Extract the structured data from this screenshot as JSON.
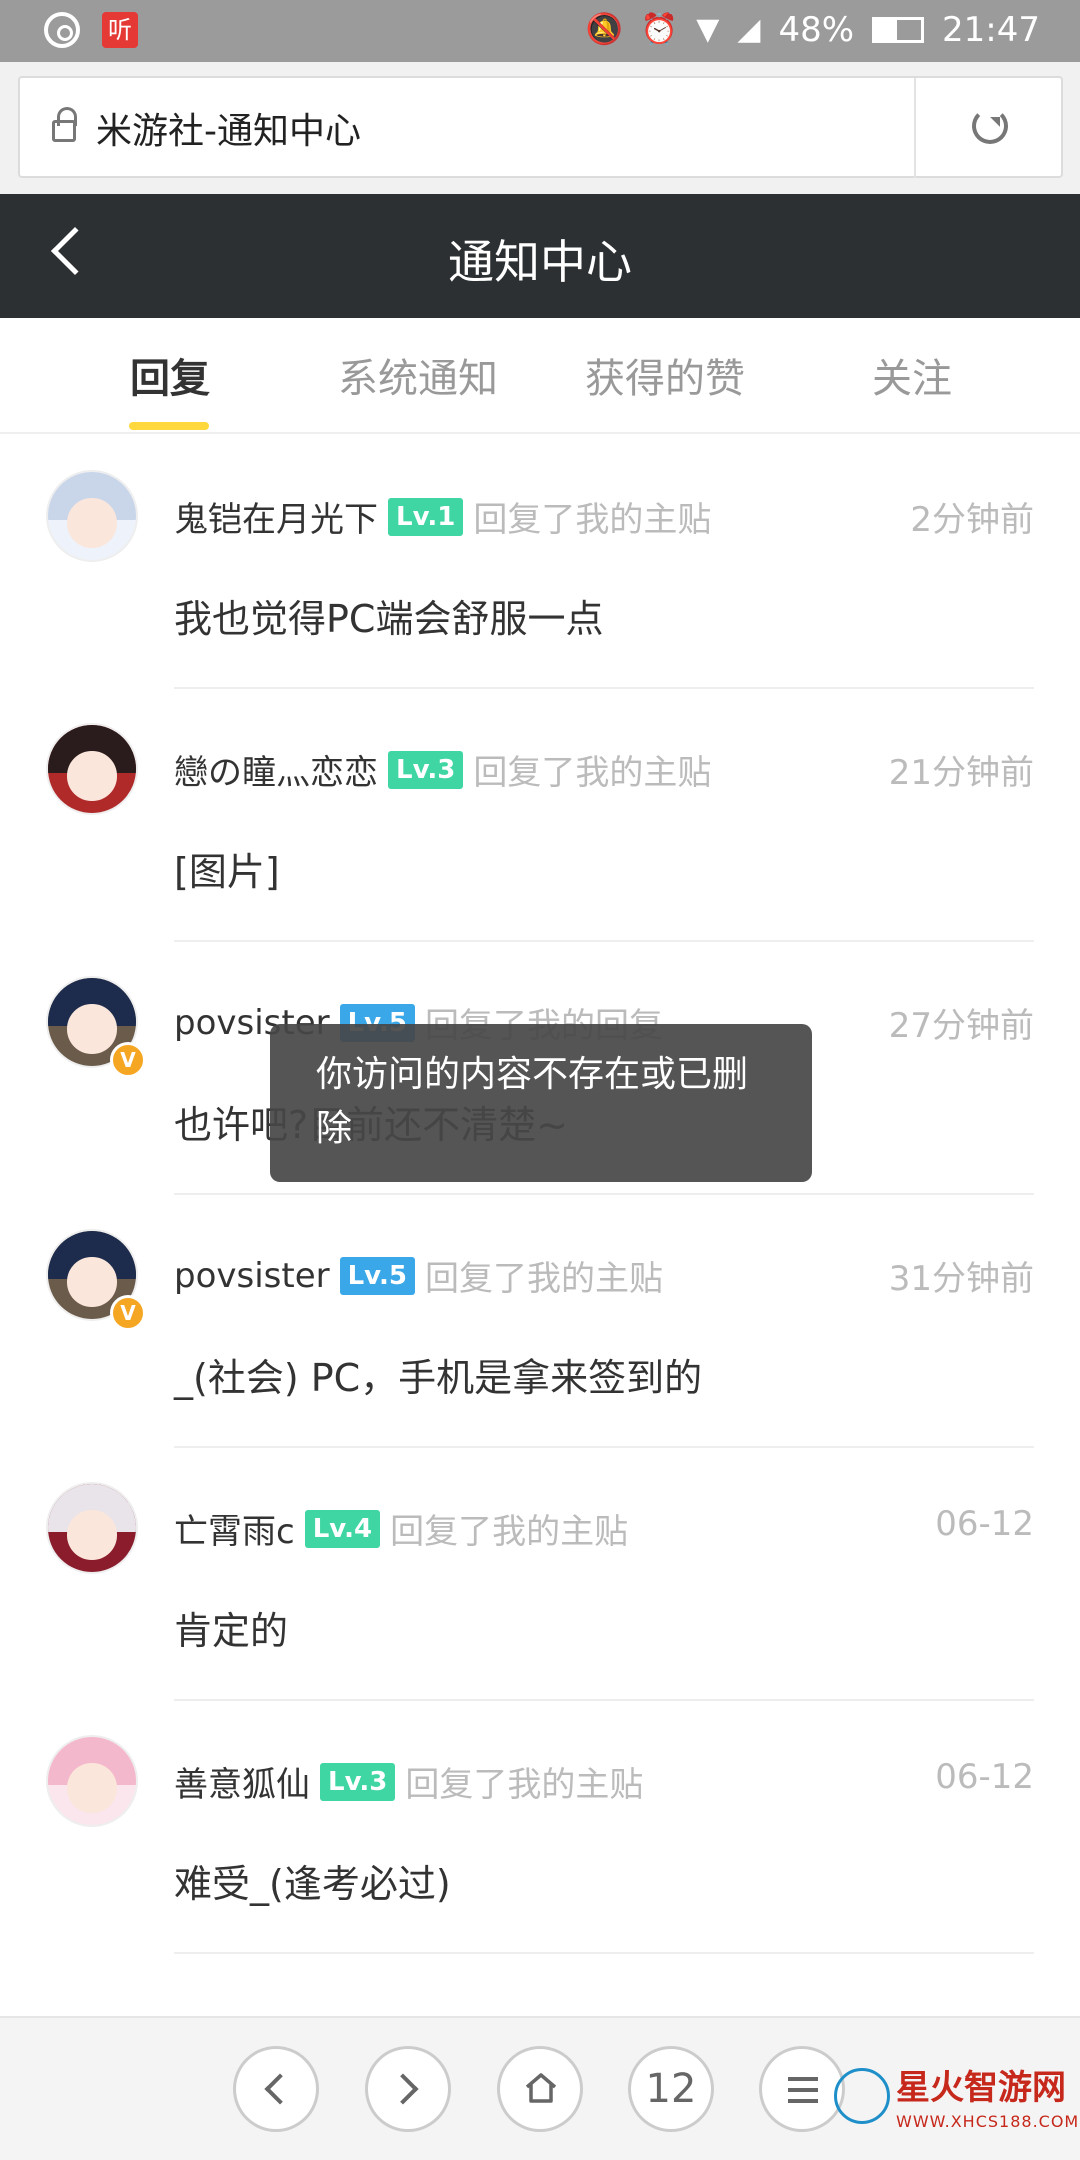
{
  "status_bar": {
    "battery": "48%",
    "time": "21:47",
    "app_icon": "听",
    "battery_fraction": 0.48
  },
  "browser": {
    "url_title": "米游社-通知中心"
  },
  "header": {
    "title": "通知中心"
  },
  "tabs": [
    {
      "label": "回复"
    },
    {
      "label": "系统通知"
    },
    {
      "label": "获得的赞"
    },
    {
      "label": "关注"
    }
  ],
  "notifications": [
    {
      "user": "鬼铠在月光下",
      "level": "Lv.1",
      "action": "回复了我的主贴",
      "time": "2分钟前",
      "content": "我也觉得PC端会舒服一点",
      "level_color": "#3fd6a4",
      "avatar_colors": [
        "#c9d6ea",
        "#eef2fa"
      ]
    },
    {
      "user": "戀の瞳灬恋恋",
      "level": "Lv.3",
      "action": "回复了我的主贴",
      "time": "21分钟前",
      "content": "[图片]",
      "level_color": "#3fd6a4",
      "avatar_colors": [
        "#2a1c1c",
        "#b02a2a"
      ]
    },
    {
      "user": "povsister",
      "level": "Lv.5",
      "action": "回复了我的回复",
      "time": "27分钟前",
      "content": "也许吧?目前还不清楚~",
      "level_color": "#3aa8e8",
      "avatar_colors": [
        "#1d2c4d",
        "#6b5b4a"
      ]
    },
    {
      "user": "povsister",
      "level": "Lv.5",
      "action": "回复了我的主贴",
      "time": "31分钟前",
      "content": "_(社会) PC，手机是拿来签到的",
      "level_color": "#3aa8e8",
      "avatar_colors": [
        "#1d2c4d",
        "#6b5b4a"
      ]
    },
    {
      "user": "亡霄雨c",
      "level": "Lv.4",
      "action": "回复了我的主贴",
      "time": "06-12",
      "content": "肯定的",
      "level_color": "#3fd6a4",
      "avatar_colors": [
        "#e9e4ea",
        "#8a1c2c"
      ]
    },
    {
      "user": "善意狐仙",
      "level": "Lv.3",
      "action": "回复了我的主贴",
      "time": "06-12",
      "content": "难受_(逢考必过)",
      "level_color": "#3fd6a4",
      "avatar_colors": [
        "#f4b8cc",
        "#fbe6ee"
      ]
    }
  ],
  "toast": {
    "message": "你访问的内容不存在或已删除"
  },
  "bottom_nav": {
    "tab_count": "12"
  },
  "watermark": {
    "brand": "星火智游网",
    "site": "WWW.XHCS188.COM"
  }
}
